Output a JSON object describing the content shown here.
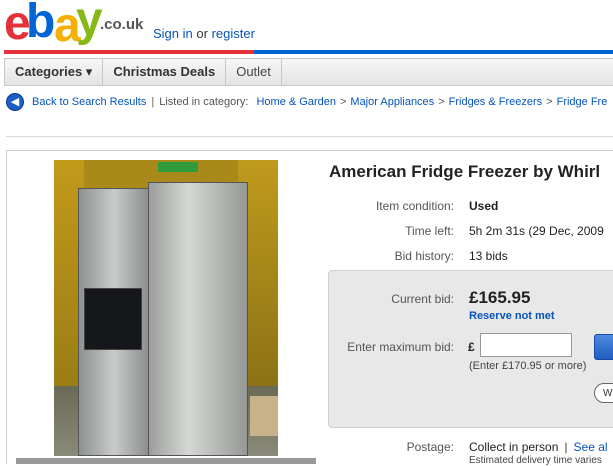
{
  "header": {
    "logo_letters": [
      "e",
      "b",
      "a",
      "y"
    ],
    "domain": ".co.uk",
    "sign_in": "Sign in",
    "or": "or",
    "register": "register",
    "brand_colors": [
      "#e53238",
      "#0064d2",
      "#f5af02",
      "#86b817"
    ]
  },
  "nav": {
    "items": [
      "Categories ▾",
      "Christmas Deals",
      "Outlet"
    ]
  },
  "breadcrumb": {
    "back": "Back to Search Results",
    "separator": "|",
    "listed_label": "Listed in category:",
    "path": [
      "Home & Garden",
      "Major Appliances",
      "Fridges & Freezers",
      "Fridge Fre"
    ],
    "arrow": ">"
  },
  "item": {
    "title": "American Fridge Freezer by Whirl",
    "condition_label": "Item condition:",
    "condition": "Used",
    "time_label": "Time left:",
    "time_left": "5h 2m 31s (29 Dec, 2009",
    "history_label": "Bid history:",
    "bids": "13 bids",
    "current_bid_label": "Current bid:",
    "current_bid": "£165.95",
    "reserve": "Reserve not met",
    "max_bid_label": "Enter maximum bid:",
    "currency": "£",
    "max_bid_value": "",
    "min_bid_hint": "(Enter £170.95 or more)",
    "watch_label": "W",
    "postage_label": "Postage:",
    "postage": "Collect in person",
    "postage_sep": "|",
    "postage_more": "See al",
    "estimate": "Estimated delivery time varies"
  }
}
